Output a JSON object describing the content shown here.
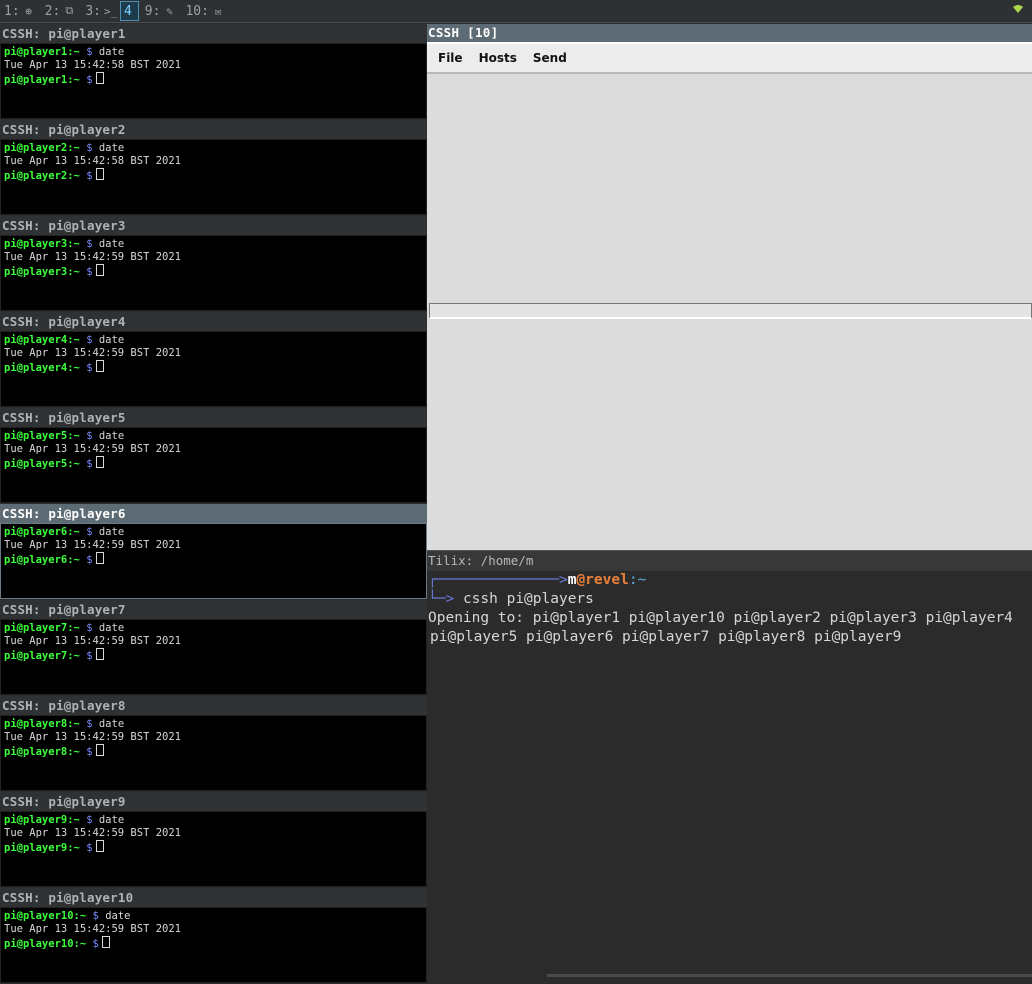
{
  "topbar": {
    "workspaces": [
      {
        "num": "1:",
        "icon": "globe-icon",
        "glyph": "⊕"
      },
      {
        "num": "2:",
        "icon": "windows-icon",
        "glyph": "⧉"
      },
      {
        "num": "3:",
        "icon": "terminal-icon",
        "glyph": ">_"
      },
      {
        "num": "4",
        "icon": "",
        "glyph": ""
      },
      {
        "num": "9:",
        "icon": "pencil-icon",
        "glyph": "✎"
      },
      {
        "num": "10:",
        "icon": "mail-icon",
        "glyph": "✉"
      }
    ],
    "wifi_icon": "wifi-icon"
  },
  "terminals": [
    {
      "title": "CSSH: pi@player1",
      "host": "pi@player1",
      "cmd": "date",
      "output": "Tue Apr 13 15:42:58 BST 2021"
    },
    {
      "title": "CSSH: pi@player2",
      "host": "pi@player2",
      "cmd": "date",
      "output": "Tue Apr 13 15:42:58 BST 2021"
    },
    {
      "title": "CSSH: pi@player3",
      "host": "pi@player3",
      "cmd": "date",
      "output": "Tue Apr 13 15:42:59 BST 2021"
    },
    {
      "title": "CSSH: pi@player4",
      "host": "pi@player4",
      "cmd": "date",
      "output": "Tue Apr 13 15:42:59 BST 2021"
    },
    {
      "title": "CSSH: pi@player5",
      "host": "pi@player5",
      "cmd": "date",
      "output": "Tue Apr 13 15:42:59 BST 2021"
    },
    {
      "title": "CSSH: pi@player6",
      "host": "pi@player6",
      "cmd": "date",
      "output": "Tue Apr 13 15:42:59 BST 2021"
    },
    {
      "title": "CSSH: pi@player7",
      "host": "pi@player7",
      "cmd": "date",
      "output": "Tue Apr 13 15:42:59 BST 2021"
    },
    {
      "title": "CSSH: pi@player8",
      "host": "pi@player8",
      "cmd": "date",
      "output": "Tue Apr 13 15:42:59 BST 2021"
    },
    {
      "title": "CSSH: pi@player9",
      "host": "pi@player9",
      "cmd": "date",
      "output": "Tue Apr 13 15:42:59 BST 2021"
    },
    {
      "title": "CSSH: pi@player10",
      "host": "pi@player10",
      "cmd": "date",
      "output": "Tue Apr 13 15:42:59 BST 2021"
    }
  ],
  "prompt_suffix": ":~",
  "prompt_dollar": "$",
  "cssh": {
    "title": "CSSH [10]",
    "menu": [
      "File",
      "Hosts",
      "Send"
    ]
  },
  "tilix": {
    "title": "Tilix: /home/m",
    "prompt_arrow_top": "┌──────────────>",
    "prompt_user": "m",
    "prompt_at": "@revel",
    "prompt_path": ":~",
    "prompt_arrow_bottom": "└─>",
    "command": "cssh pi@players",
    "output_line1": "Opening to: pi@player1 pi@player10 pi@player2 pi@player3 pi@player4",
    "output_line2": "pi@player5 pi@player6 pi@player7 pi@player8 pi@player9"
  },
  "colors": {
    "active_title": "#5d6c74",
    "prompt_green": "#3cff3c",
    "accent_blue": "#7fd1ff"
  }
}
